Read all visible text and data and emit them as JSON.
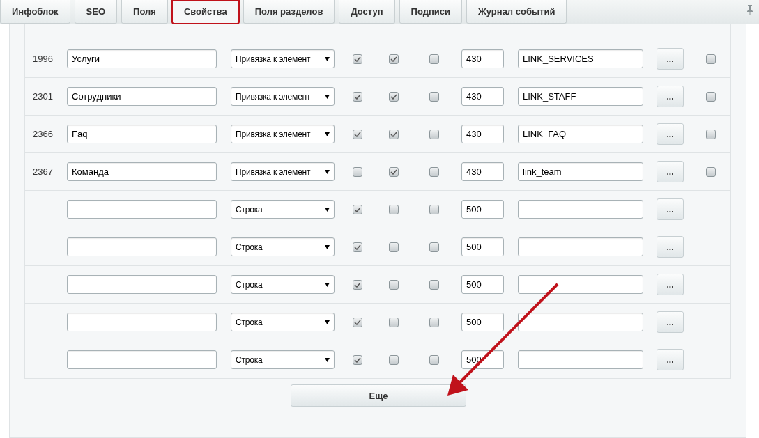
{
  "tabs": [
    {
      "label": "Инфоблок",
      "selected": false,
      "highlighted": false
    },
    {
      "label": "SEO",
      "selected": false,
      "highlighted": false
    },
    {
      "label": "Поля",
      "selected": false,
      "highlighted": false
    },
    {
      "label": "Свойства",
      "selected": true,
      "highlighted": true
    },
    {
      "label": "Поля разделов",
      "selected": false,
      "highlighted": false
    },
    {
      "label": "Доступ",
      "selected": false,
      "highlighted": false
    },
    {
      "label": "Подписи",
      "selected": false,
      "highlighted": false
    },
    {
      "label": "Журнал событий",
      "selected": false,
      "highlighted": false
    }
  ],
  "rows": [
    {
      "id": "1996",
      "name": "Услуги",
      "type": "Привязка к элемент",
      "active": true,
      "multiple": true,
      "required": false,
      "sort": "430",
      "code": "LINK_SERVICES",
      "edit": "...",
      "delete": false
    },
    {
      "id": "2301",
      "name": "Сотрудники",
      "type": "Привязка к элемент",
      "active": true,
      "multiple": true,
      "required": false,
      "sort": "430",
      "code": "LINK_STAFF",
      "edit": "...",
      "delete": false
    },
    {
      "id": "2366",
      "name": "Faq",
      "type": "Привязка к элемент",
      "active": true,
      "multiple": true,
      "required": false,
      "sort": "430",
      "code": "LINK_FAQ",
      "edit": "...",
      "delete": false
    },
    {
      "id": "2367",
      "name": "Команда",
      "type": "Привязка к элемент",
      "active": false,
      "multiple": true,
      "required": false,
      "sort": "430",
      "code": "link_team",
      "edit": "...",
      "delete": false
    },
    {
      "type": "Строка",
      "active": true,
      "multiple": false,
      "required": false,
      "sort": "500",
      "edit": "..."
    },
    {
      "type": "Строка",
      "active": true,
      "multiple": false,
      "required": false,
      "sort": "500",
      "edit": "..."
    },
    {
      "type": "Строка",
      "active": true,
      "multiple": false,
      "required": false,
      "sort": "500",
      "edit": "..."
    },
    {
      "type": "Строка",
      "active": true,
      "multiple": false,
      "required": false,
      "sort": "500",
      "edit": "..."
    },
    {
      "type": "Строка",
      "active": true,
      "multiple": false,
      "required": false,
      "sort": "500",
      "edit": "..."
    }
  ],
  "more_button": "Еще"
}
